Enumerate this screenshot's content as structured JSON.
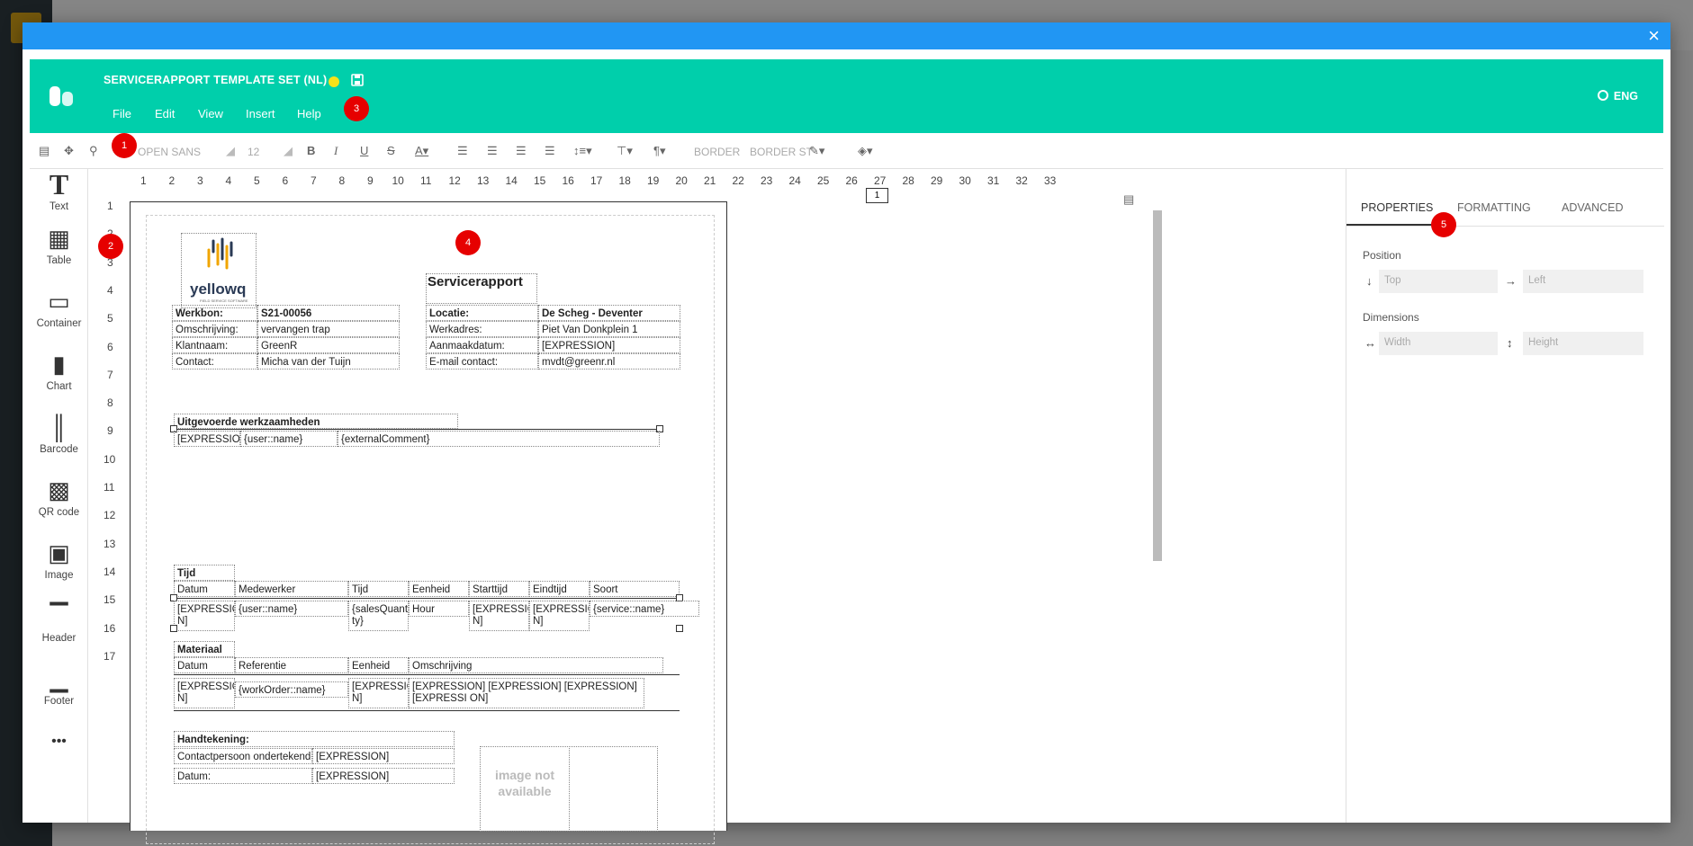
{
  "modal": {
    "close": "×"
  },
  "header": {
    "title": "SERVICERAPPORT TEMPLATE SET (NL)",
    "menu": [
      "File",
      "Edit",
      "View",
      "Insert",
      "Help"
    ],
    "language": "ENG"
  },
  "toolbar": {
    "font": "OPEN SANS",
    "size": "12",
    "bold": "B",
    "italic": "I",
    "underline": "U",
    "strike": "S",
    "border1": "BORDER",
    "border2": "BORDER ST"
  },
  "badges": [
    "1",
    "2",
    "3",
    "4",
    "5"
  ],
  "leftbar": [
    {
      "label": "Text",
      "icon": "T"
    },
    {
      "label": "Table",
      "icon": "▦"
    },
    {
      "label": "Container",
      "icon": "▭"
    },
    {
      "label": "Chart",
      "icon": "▮"
    },
    {
      "label": "Barcode",
      "icon": "║"
    },
    {
      "label": "QR code",
      "icon": "▩"
    },
    {
      "label": "Image",
      "icon": "▣"
    },
    {
      "label": "Header",
      "icon": "▔"
    },
    {
      "label": "Footer",
      "icon": "▁"
    },
    {
      "label": "",
      "icon": "•••"
    }
  ],
  "ruler": {
    "h": [
      "1",
      "2",
      "3",
      "4",
      "5",
      "6",
      "7",
      "8",
      "9",
      "10",
      "11",
      "12",
      "13",
      "14",
      "15",
      "16",
      "17",
      "18",
      "19",
      "20",
      "21",
      "22",
      "23",
      "24",
      "25",
      "26",
      "27",
      "28",
      "29",
      "30",
      "31",
      "32",
      "33"
    ],
    "v": [
      "1",
      "2",
      "3",
      "4",
      "5",
      "6",
      "7",
      "8",
      "9",
      "10",
      "11",
      "12",
      "13",
      "14",
      "15",
      "16",
      "17"
    ]
  },
  "page_number": "1",
  "document": {
    "logo_text": "yellowq",
    "logo_sub": "FIELD SERVICE SOFTWARE",
    "title": "Servicerapport",
    "info_left": [
      [
        "Werkbon:",
        "S21-00056"
      ],
      [
        "Omschrijving:",
        "vervangen trap"
      ],
      [
        "Klantnaam:",
        "GreenR"
      ],
      [
        "Contact:",
        "Micha van der Tuijn"
      ]
    ],
    "info_right": [
      [
        "Locatie:",
        "De Scheg - Deventer"
      ],
      [
        "Werkadres:",
        "Piet Van Donkplein 1"
      ],
      [
        "Aanmaakdatum:",
        "[EXPRESSION]"
      ],
      [
        "E-mail contact:",
        "mvdt@greenr.nl"
      ]
    ],
    "work_title": "Uitgevoerde werkzaamheden",
    "work_row": [
      "[EXPRESSION]",
      "{user::name}",
      "{externalComment}"
    ],
    "time_title": "Tijd",
    "time_headers": [
      "Datum",
      "Medewerker",
      "Tijd",
      "Eenheid",
      "Starttijd",
      "Eindtijd",
      "Soort"
    ],
    "time_row": [
      "[EXPRESSIO N]",
      "{user::name}",
      "{salesQuanti ty}",
      "Hour",
      "[EXPRESSIO N]",
      "[EXPRESSIO N]",
      "{service::name}"
    ],
    "mat_title": "Materiaal",
    "mat_headers": [
      "Datum",
      "Referentie",
      "Eenheid",
      "Omschrijving"
    ],
    "mat_row": [
      "[EXPRESSIO N]",
      "{workOrder::name}",
      "[EXPRESSIO N]",
      "[EXPRESSION] [EXPRESSION] [EXPRESSION] [EXPRESSI ON]"
    ],
    "sign_title": "Handtekening:",
    "sign_rows": [
      [
        "Contactpersoon ondertekende:",
        "[EXPRESSION]"
      ],
      [
        "Datum:",
        "[EXPRESSION]"
      ]
    ],
    "image_placeholder": "image not available"
  },
  "panel": {
    "tabs": [
      "PROPERTIES",
      "FORMATTING",
      "ADVANCED"
    ],
    "position_label": "Position",
    "top_placeholder": "Top",
    "left_placeholder": "Left",
    "dimensions_label": "Dimensions",
    "width_placeholder": "Width",
    "height_placeholder": "Height"
  },
  "colors": {
    "header": "#00cfab",
    "modal_bar": "#2196f3",
    "badge": "#e60000",
    "status_dot": "#f6e21a"
  }
}
